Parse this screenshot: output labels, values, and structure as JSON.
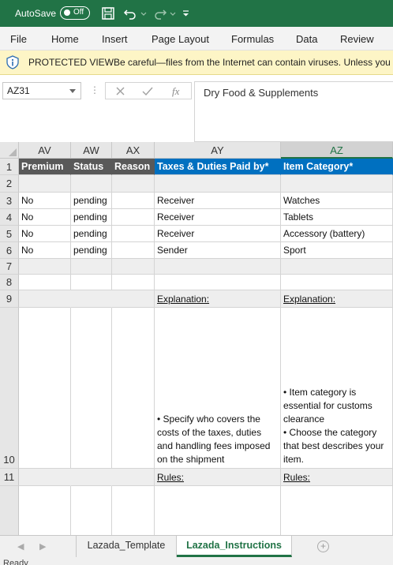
{
  "titlebar": {
    "autosave_label": "AutoSave",
    "toggle_state": "Off",
    "bg_color": "#217346"
  },
  "ribbon": {
    "tabs": [
      "File",
      "Home",
      "Insert",
      "Page Layout",
      "Formulas",
      "Data",
      "Review"
    ]
  },
  "protected_view": {
    "title": "PROTECTED VIEW",
    "message": "Be careful—files from the Internet can contain viruses. Unless you need to edit, it's safer to stay in Protected View.",
    "bg_color": "#fdf5c6"
  },
  "formula_bar": {
    "name_box": "AZ31",
    "fx_label": "fx",
    "content": "Dry Food & Supplements"
  },
  "grid": {
    "columns": [
      "AV",
      "AW",
      "AX",
      "AY",
      "AZ"
    ],
    "active_column": "AZ",
    "row_numbers": [
      "1",
      "2",
      "3",
      "4",
      "5",
      "6",
      "7",
      "8",
      "9",
      "10",
      "11"
    ],
    "header_row": [
      "Premium",
      "Status",
      "Reason",
      "Taxes & Duties Paid by*",
      "Item Category*"
    ],
    "data_rows": [
      [
        "No",
        "pending",
        "",
        "Receiver",
        "Watches"
      ],
      [
        "No",
        "pending",
        "",
        "Receiver",
        "Tablets"
      ],
      [
        "No",
        "pending",
        "",
        "Receiver",
        "Accessory (battery)"
      ],
      [
        "No",
        "pending",
        "",
        "Sender",
        "Sport"
      ]
    ],
    "explanation_label": "Explanation:",
    "ay_explanation": "• Specify who covers the costs of the taxes, duties and handling fees imposed on the shipment",
    "az_explanation_1": "• Item category is essential for customs clearance",
    "az_explanation_2": "• Choose the category that best describes your item.",
    "rules_label": "Rules:",
    "colors": {
      "dark_header": "#595959",
      "blue_header": "#0070c0"
    }
  },
  "sheet_tabs": {
    "tabs": [
      "Lazada_Template",
      "Lazada_Instructions"
    ],
    "active": "Lazada_Instructions",
    "add_symbol": "+"
  },
  "status_bar": {
    "text": "Ready"
  }
}
